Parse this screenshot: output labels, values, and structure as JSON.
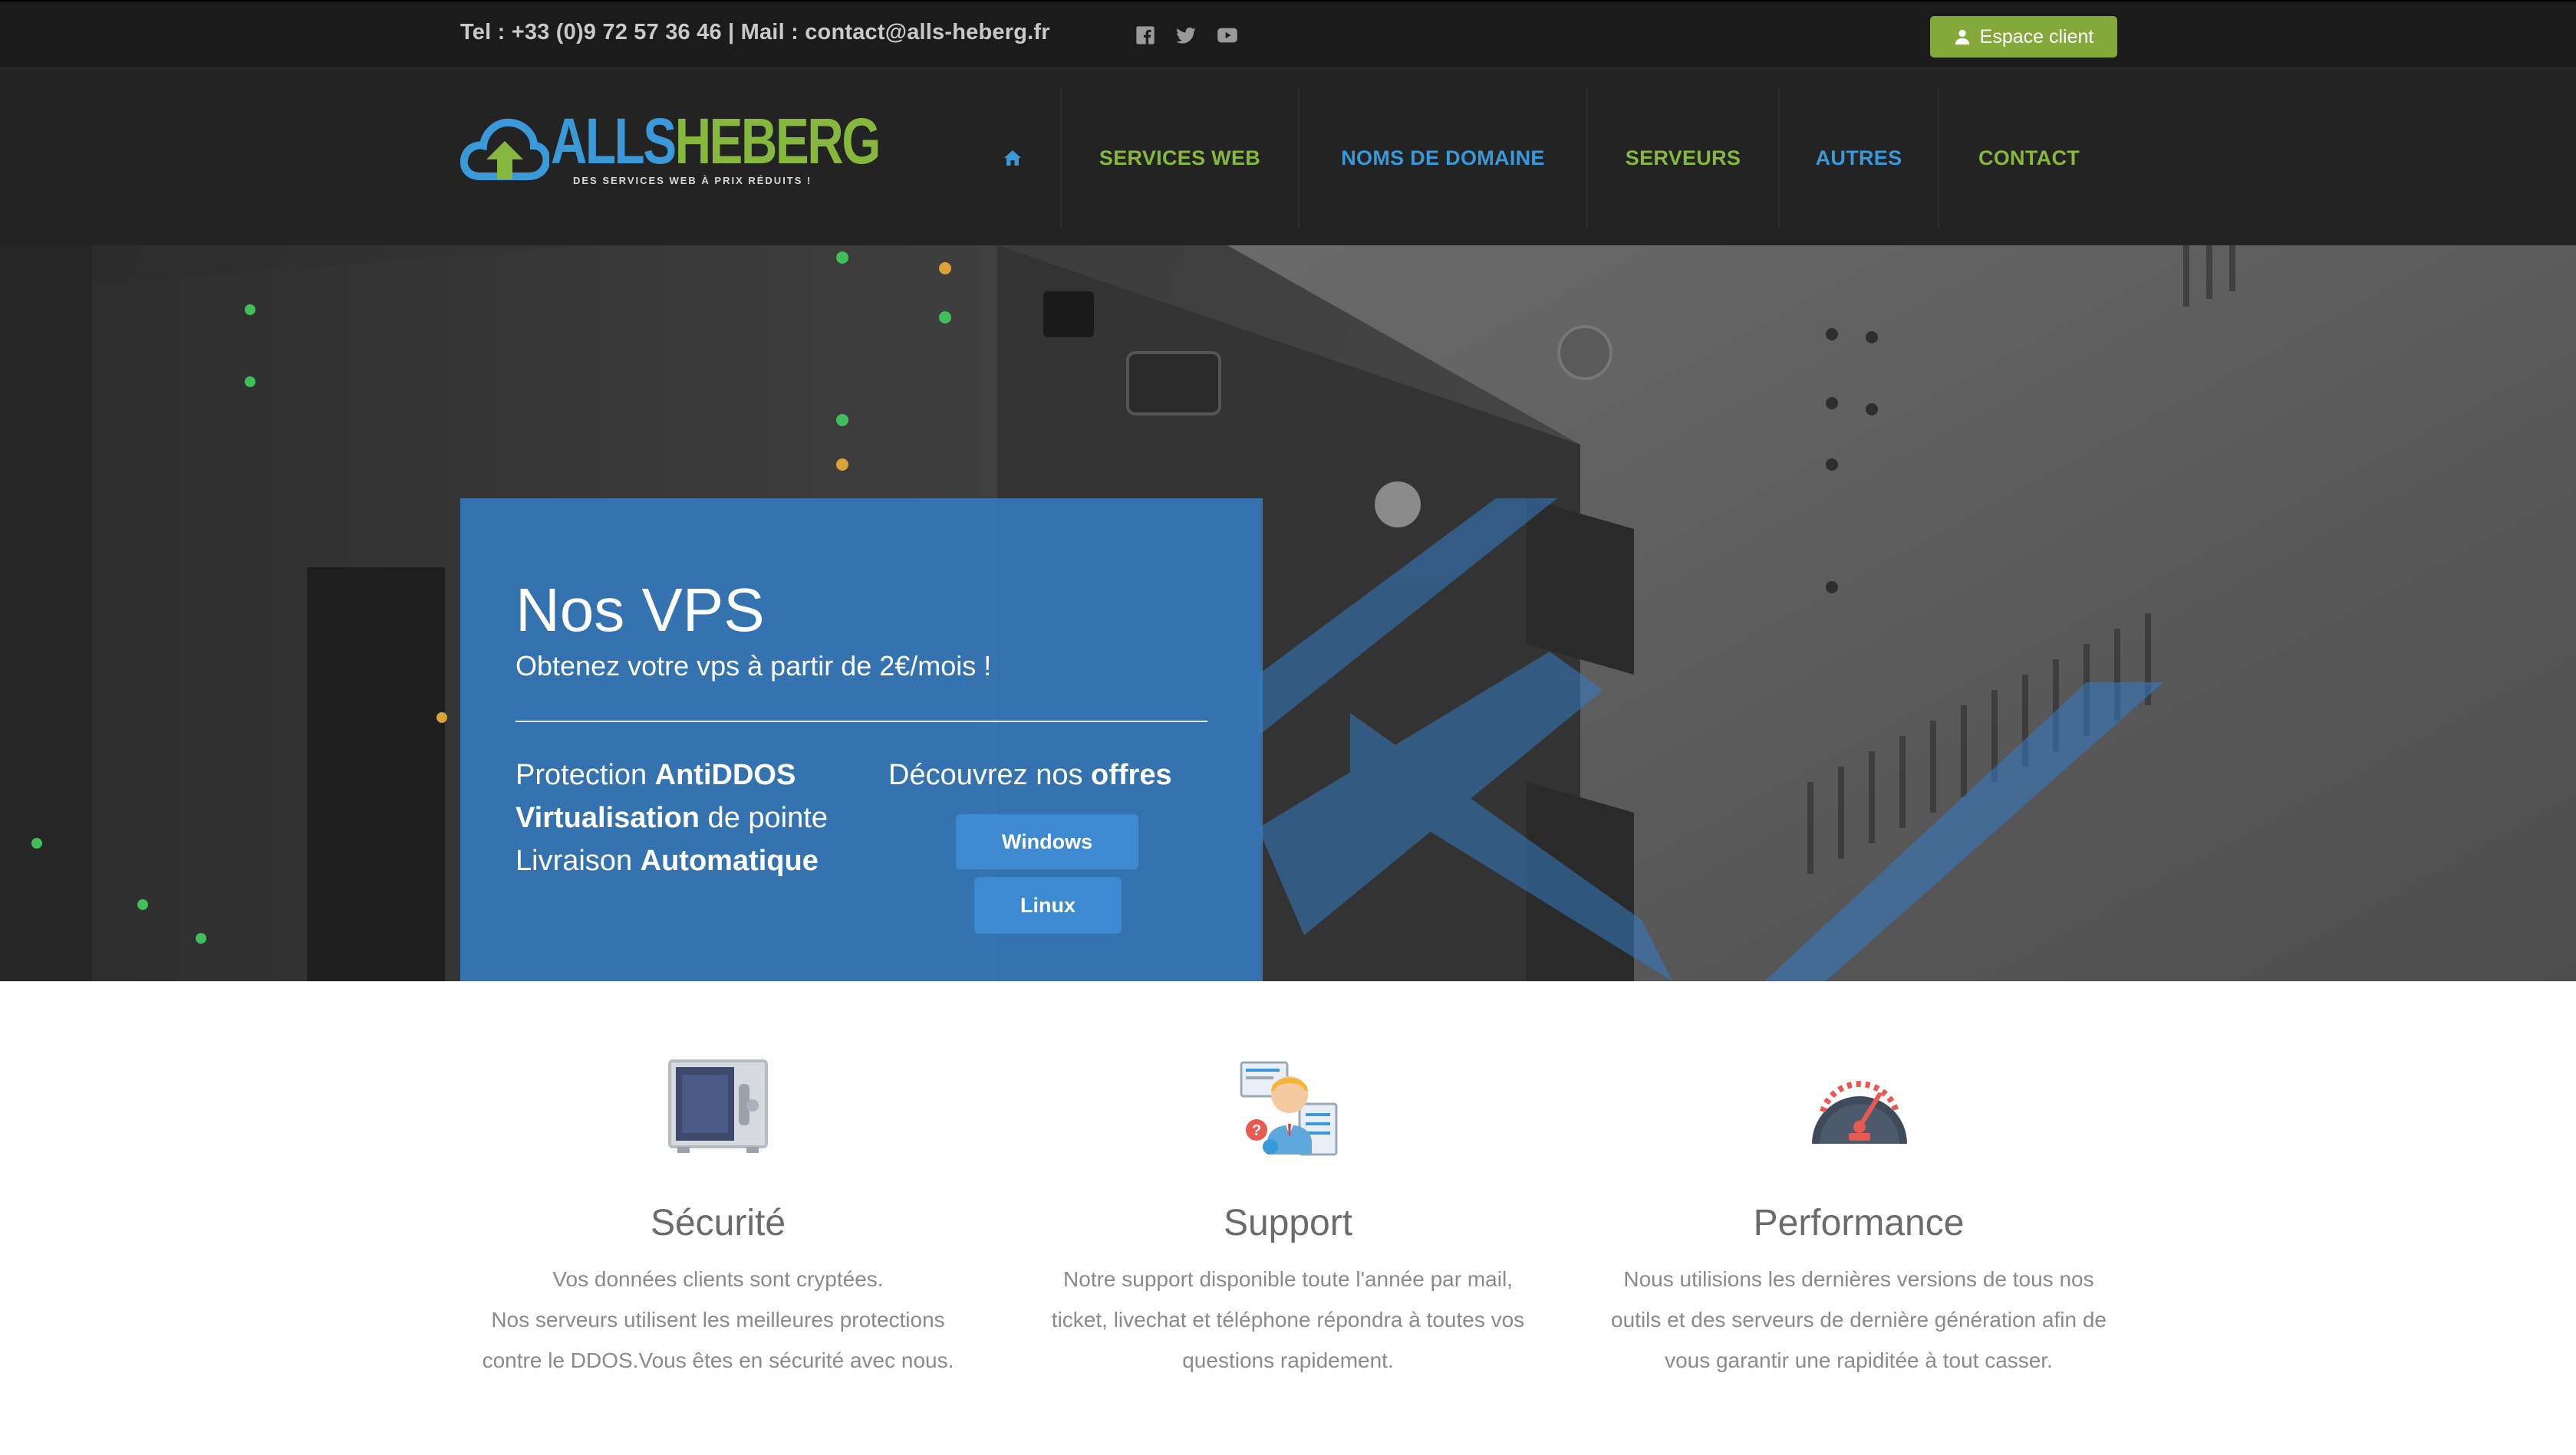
{
  "topbar": {
    "contact": "Tel : +33 (0)9 72 57 36 46 | Mail : contact@alls-heberg.fr",
    "social": [
      "facebook-icon",
      "twitter-icon",
      "youtube-icon"
    ],
    "espace_label": "Espace client"
  },
  "logo": {
    "word_part1": "ALLS",
    "word_part2": "HEBERG",
    "tagline": "DES SERVICES WEB À PRIX RÉDUITS !"
  },
  "nav": {
    "home_icon": "home-icon",
    "items": [
      {
        "label": "SERVICES WEB",
        "color": "#86b83d"
      },
      {
        "label": "NOMS DE DOMAINE",
        "color": "#3a9ad9"
      },
      {
        "label": "SERVEURS",
        "color": "#86b83d"
      },
      {
        "label": "AUTRES",
        "color": "#3a9ad9"
      },
      {
        "label": "CONTACT",
        "color": "#86b83d"
      }
    ]
  },
  "hero": {
    "title": "Nos VPS",
    "subtitle": "Obtenez votre vps à partir de 2€/mois !",
    "features": [
      {
        "pre": "Protection ",
        "bold": "AntiDDOS",
        "post": ""
      },
      {
        "pre": "",
        "bold": "Virtualisation",
        "post": " de pointe"
      },
      {
        "pre": "Livraison ",
        "bold": "Automatique",
        "post": ""
      }
    ],
    "discover_pre": "Découvrez nos ",
    "discover_bold": "offres",
    "buttons": [
      "Windows",
      "Linux"
    ]
  },
  "features": [
    {
      "icon": "safe-icon",
      "title": "Sécurité",
      "lines": [
        "Vos données clients sont cryptées.",
        "Nos serveurs utilisent les meilleures protections",
        "contre le DDOS.Vous êtes en sécurité avec nous."
      ]
    },
    {
      "icon": "support-agent-icon",
      "title": "Support",
      "lines": [
        "Notre support disponible toute l'année par mail,",
        "ticket, livechat et téléphone répondra à toutes vos",
        "questions rapidement."
      ]
    },
    {
      "icon": "speedometer-icon",
      "title": "Performance",
      "lines": [
        "Nous utilisions les dernières versions de tous nos",
        "outils et des serveurs de dernière génération afin de",
        "vous garantir une rapiditée à tout casser."
      ]
    }
  ],
  "colors": {
    "brand_blue": "#3a9ad9",
    "brand_green": "#86b83d",
    "button_green": "#84a93b",
    "panel_blue": "#347cc4"
  }
}
